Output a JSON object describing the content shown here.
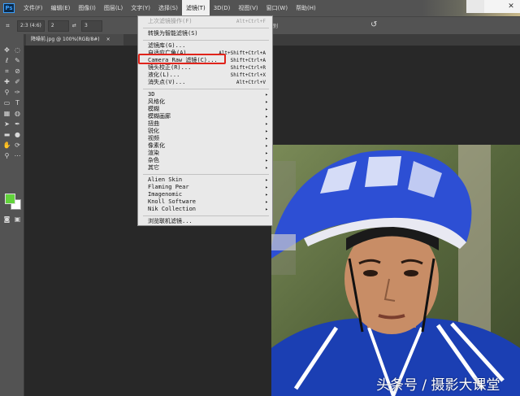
{
  "app": {
    "logo": "Ps"
  },
  "menubar": {
    "items": [
      "文件(F)",
      "编辑(E)",
      "图像(I)",
      "图层(L)",
      "文字(Y)",
      "选择(S)",
      "滤镜(T)",
      "3D(D)",
      "视图(V)",
      "窗口(W)",
      "帮助(H)"
    ],
    "active_index": 6
  },
  "options": {
    "ratio": "2:3 (4:6)",
    "ratio_w": "2",
    "ratio_h": "3",
    "delete_label": "内容识别"
  },
  "document": {
    "tab_label": "降噪前.jpg @ 100%(RGB/8#)"
  },
  "colors": {
    "foreground": "#62d33c",
    "background": "#ffffff",
    "highlight": "#e0241b"
  },
  "filter_menu": {
    "last_filter": {
      "label": "上次滤镜操作(F)",
      "shortcut": "Alt+Ctrl+F"
    },
    "convert_smart": "转换为智能滤镜(S)",
    "group1": [
      {
        "label": "滤镜库(G)...",
        "shortcut": ""
      },
      {
        "label": "自适应广角(A)...",
        "shortcut": "Alt+Shift+Ctrl+A"
      },
      {
        "label": "Camera Raw 滤镜(C)...",
        "shortcut": "Shift+Ctrl+A"
      },
      {
        "label": "镜头校正(R)...",
        "shortcut": "Shift+Ctrl+R"
      },
      {
        "label": "液化(L)...",
        "shortcut": "Shift+Ctrl+X"
      },
      {
        "label": "消失点(V)...",
        "shortcut": "Alt+Ctrl+V"
      }
    ],
    "group2": [
      "3D",
      "风格化",
      "模糊",
      "模糊画廊",
      "扭曲",
      "锐化",
      "视频",
      "像素化",
      "渲染",
      "杂色",
      "其它"
    ],
    "plugins": [
      "Alien Skin",
      "Flaming Pear",
      "Imagenomic",
      "Knoll Software",
      "Nik Collection"
    ],
    "browse": "浏览联机滤镜..."
  },
  "watermark": "头条号 / 摄影大课堂"
}
